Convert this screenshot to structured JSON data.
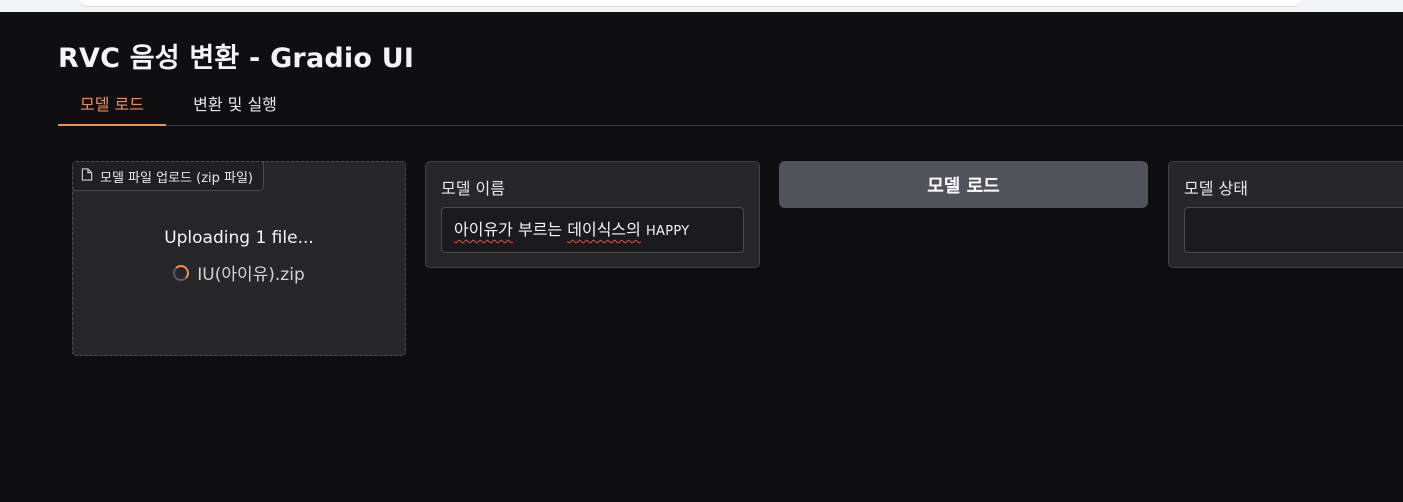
{
  "app": {
    "title": "RVC 음성 변환 - Gradio UI"
  },
  "tabs": [
    {
      "label": "모델 로드",
      "active": true
    },
    {
      "label": "변환 및 실행",
      "active": false
    }
  ],
  "upload": {
    "label": "모델 파일 업로드 (zip 파일)",
    "icon": "file-icon",
    "status_text": "Uploading 1 file...",
    "file_name": "IU(아이유).zip"
  },
  "model_name": {
    "label": "모델 이름",
    "value_part1": "아이유가",
    "value_part2": "부르는",
    "value_part3": "데이식스의",
    "value_part4": "HAPPY"
  },
  "load_button": {
    "label": "모델 로드"
  },
  "model_status": {
    "label": "모델 상태",
    "value": ""
  },
  "colors": {
    "accent": "#f08f52",
    "background": "#0f0f11",
    "panel": "#27272a",
    "button": "#52525b"
  }
}
